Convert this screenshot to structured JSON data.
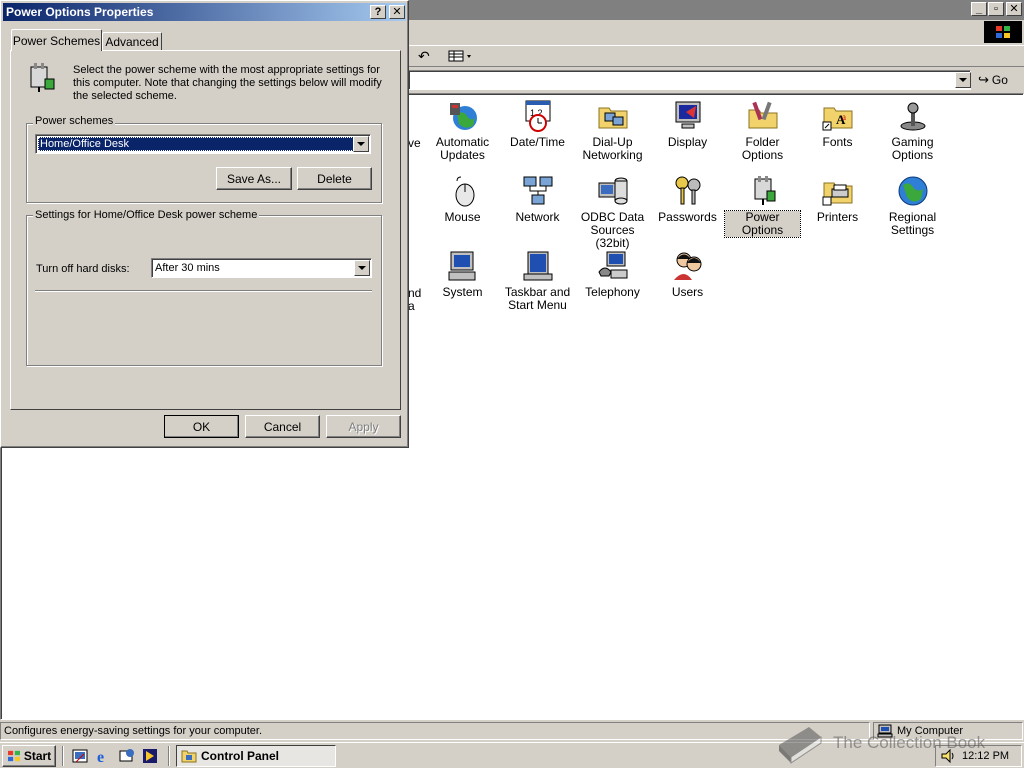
{
  "control_panel": {
    "address_go": "Go",
    "icons": [
      {
        "label": "Automatic Updates"
      },
      {
        "label": "Date/Time"
      },
      {
        "label": "Dial-Up Networking"
      },
      {
        "label": "Display"
      },
      {
        "label": "Folder Options"
      },
      {
        "label": "Fonts"
      },
      {
        "label": "Gaming Options"
      },
      {
        "label": "Mouse"
      },
      {
        "label": "Network"
      },
      {
        "label": "ODBC Data Sources (32bit)"
      },
      {
        "label": "Passwords"
      },
      {
        "label": "Power Options"
      },
      {
        "label": "Printers"
      },
      {
        "label": "Regional Settings"
      },
      {
        "label": "System"
      },
      {
        "label": "Taskbar and Start Menu"
      },
      {
        "label": "Telephony"
      },
      {
        "label": "Users"
      }
    ],
    "partial_labels": {
      "row1": "ve",
      "row3a": "nd",
      "row3b": "a"
    },
    "status_text": "Configures energy-saving settings for your computer.",
    "status_zone": "My Computer"
  },
  "dialog": {
    "title": "Power Options Properties",
    "help_btn": "?",
    "close_btn": "✕",
    "tabs": [
      "Power Schemes",
      "Advanced"
    ],
    "description": "Select the power scheme with the most appropriate settings for this computer. Note that changing the settings below will modify the selected scheme.",
    "schemes_group": "Power schemes",
    "scheme_selected": "Home/Office Desk",
    "save_as": "Save As...",
    "delete": "Delete",
    "settings_group": "Settings for Home/Office Desk power scheme",
    "hdd_label": "Turn off hard disks:",
    "hdd_value": "After 30 mins",
    "ok": "OK",
    "cancel": "Cancel",
    "apply": "Apply"
  },
  "taskbar": {
    "start": "Start",
    "task": "Control Panel",
    "clock": "12:12 PM"
  },
  "watermark": "The Collection Book"
}
